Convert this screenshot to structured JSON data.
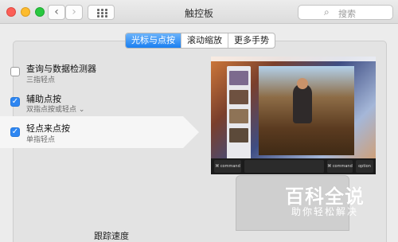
{
  "window": {
    "title": "触控板",
    "search_placeholder": "搜索",
    "nav_back": "‹",
    "nav_forward": "›"
  },
  "tabs": [
    {
      "label": "光标与点按",
      "active": true
    },
    {
      "label": "滚动缩放",
      "active": false
    },
    {
      "label": "更多手势",
      "active": false
    }
  ],
  "options": [
    {
      "label": "查询与数据检测器",
      "sub": "三指轻点",
      "checked": false
    },
    {
      "label": "辅助点按",
      "sub": "双指点按或轻点 ⌄",
      "checked": true
    },
    {
      "label": "轻点来点按",
      "sub": "单指轻点",
      "checked": true
    }
  ],
  "tracking_speed_label": "跟踪速度",
  "keyboard_keys": {
    "left": "⌘",
    "left_sub": "command",
    "right": "⌘",
    "right_sub": "command",
    "option": "option"
  },
  "watermark": {
    "title": "百科全说",
    "subtitle": "助你轻松解决"
  },
  "colors": {
    "accent": "#2d86f2",
    "tab_active": "#1a7ff1",
    "close": "#fc5f57",
    "minimize": "#fdbc2e",
    "zoom": "#29c840"
  },
  "icons": {
    "search": "magnifier",
    "grid": "grid-dots",
    "check": "checkmark"
  }
}
